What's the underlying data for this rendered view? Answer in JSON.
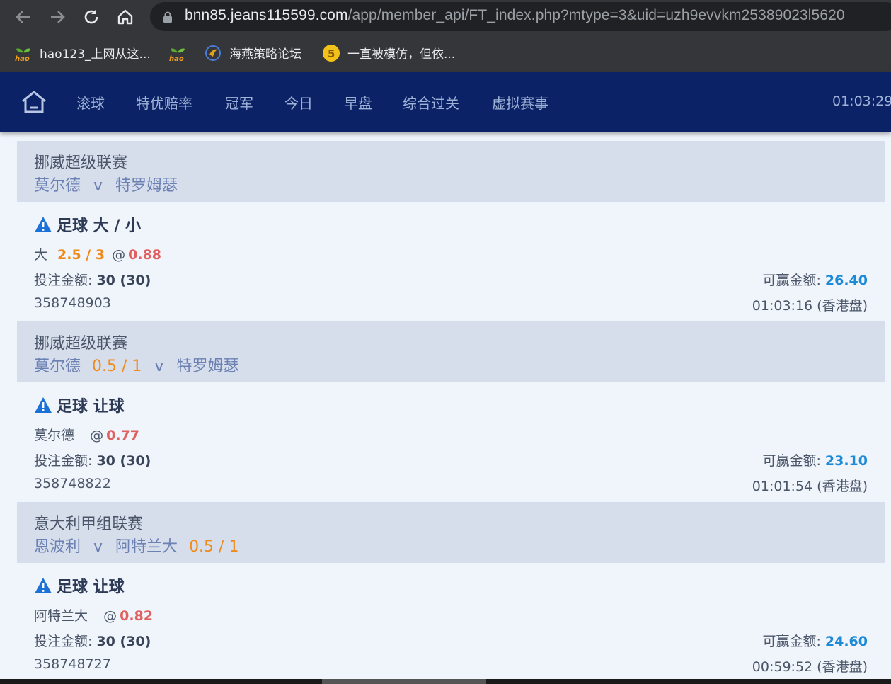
{
  "browser": {
    "url_host": "bnn85.jeans115599.com",
    "url_rest": "/app/member_api/FT_index.php?mtype=3&uid=uzh9evvkm25389023l5620",
    "bookmarks": [
      {
        "label": "hao123_上网从这...",
        "icon": "hao-logo-icon"
      },
      {
        "label": "",
        "icon": "hao-logo-icon"
      },
      {
        "label": "海燕策略论坛",
        "icon": "forum-logo-icon"
      },
      {
        "label": "一直被模仿，但依...",
        "icon": "coin-logo-icon"
      }
    ]
  },
  "nav": {
    "items": [
      "滚球",
      "特优赔率",
      "冠军",
      "今日",
      "早盘",
      "综合过关",
      "虚拟赛事"
    ],
    "clock": "01:03:29"
  },
  "bets": [
    {
      "league": "挪威超级联赛",
      "home": "莫尔德",
      "away": "特罗姆瑟",
      "vs": "v",
      "handicap_home": "",
      "handicap_away": "",
      "bet_type": "足球 大 / 小",
      "selection": "大",
      "line": "2.5 / 3",
      "at": "@",
      "odds": "0.88",
      "stake_label": "投注金额:",
      "stake_value": "30 (30)",
      "win_label": "可赢金额:",
      "win_value": "26.40",
      "ticket": "358748903",
      "time": "01:03:16 (香港盘)"
    },
    {
      "league": "挪威超级联赛",
      "home": "莫尔德",
      "away": "特罗姆瑟",
      "vs": "v",
      "handicap_home": "0.5 / 1",
      "handicap_away": "",
      "bet_type": "足球 让球",
      "selection": "莫尔德",
      "line": "",
      "at": "@",
      "odds": "0.77",
      "stake_label": "投注金额:",
      "stake_value": "30 (30)",
      "win_label": "可赢金额:",
      "win_value": "23.10",
      "ticket": "358748822",
      "time": "01:01:54 (香港盘)"
    },
    {
      "league": "意大利甲组联赛",
      "home": "恩波利",
      "away": "阿特兰大",
      "vs": "v",
      "handicap_home": "",
      "handicap_away": "0.5 / 1",
      "bet_type": "足球 让球",
      "selection": "阿特兰大",
      "line": "",
      "at": "@",
      "odds": "0.82",
      "stake_label": "投注金额:",
      "stake_value": "30 (30)",
      "win_label": "可赢金额:",
      "win_value": "24.60",
      "ticket": "358748727",
      "time": "00:59:52 (香港盘)"
    }
  ]
}
